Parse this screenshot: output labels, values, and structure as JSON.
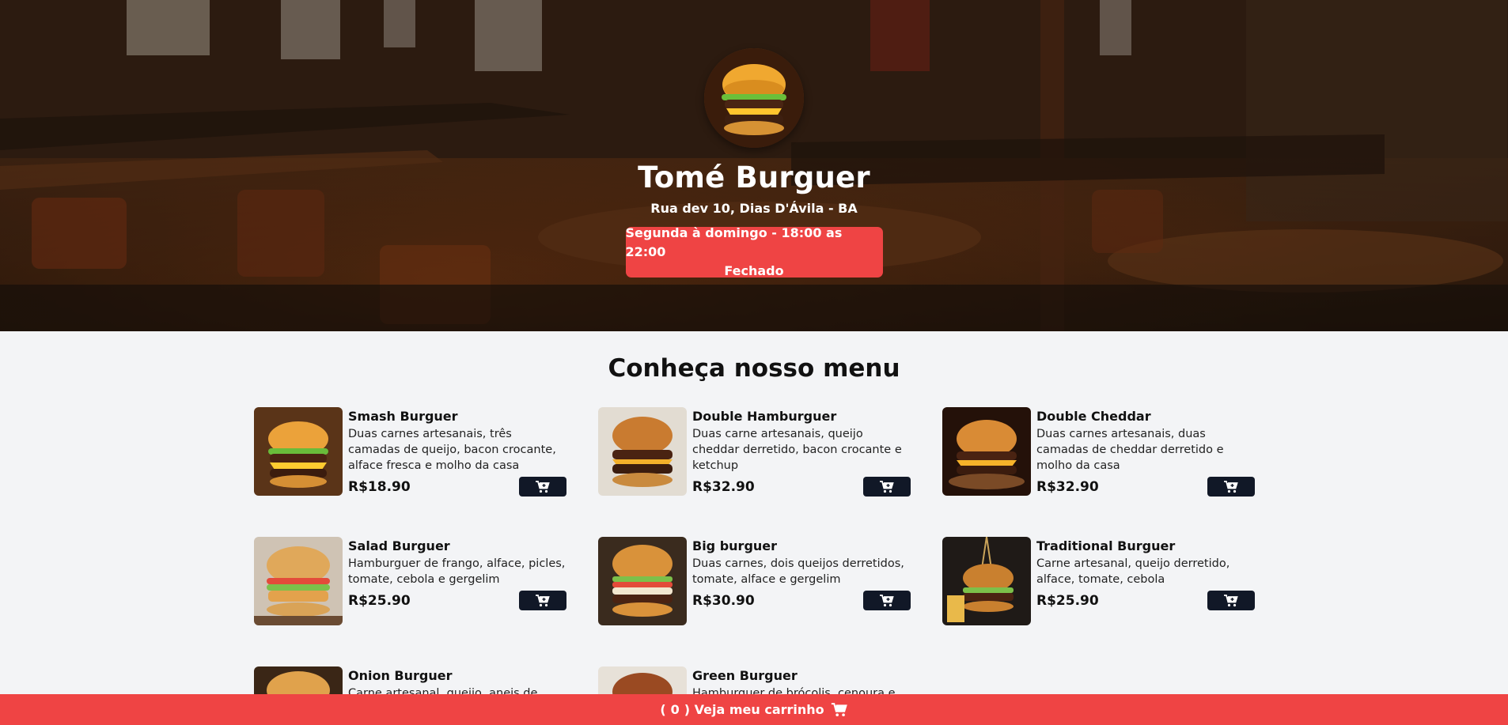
{
  "header": {
    "name": "Tomé Burguer",
    "address": "Rua dev 10, Dias D'Ávila - BA",
    "hours": "Segunda à domingo - 18:00 as 22:00",
    "status": "Fechado",
    "logo_icon": "burger-logo-icon"
  },
  "menu": {
    "title": "Conheça nosso menu",
    "items": [
      {
        "name": "Smash Burguer",
        "description": "Duas carnes artesanais, três camadas de queijo, bacon crocante, alface fresca e molho da casa",
        "price": "R$18.90"
      },
      {
        "name": "Double Hamburguer",
        "description": "Duas carne artesanais, queijo cheddar derretido, bacon crocante e ketchup",
        "price": "R$32.90"
      },
      {
        "name": "Double Cheddar",
        "description": "Duas carnes artesanais, duas camadas de cheddar derretido e molho da casa",
        "price": "R$32.90"
      },
      {
        "name": "Salad Burguer",
        "description": "Hamburguer de frango, alface, picles, tomate, cebola e gergelim",
        "price": "R$25.90"
      },
      {
        "name": "Big burguer",
        "description": "Duas carnes, dois queijos derretidos, tomate, alface e gergelim",
        "price": "R$30.90"
      },
      {
        "name": "Traditional Burguer",
        "description": "Carne artesanal, queijo derretido, alface, tomate, cebola",
        "price": "R$25.90"
      },
      {
        "name": "Onion Burguer",
        "description": "Carne artesanal, queijo, aneis de",
        "price": ""
      },
      {
        "name": "Green Burguer",
        "description": "Hamburguer de brócolis, cenoura e",
        "price": ""
      }
    ]
  },
  "cart": {
    "open_paren": "(",
    "count": "0",
    "label": ") Veja meu carrinho",
    "icon": "cart-icon"
  },
  "colors": {
    "accent": "#ef4444",
    "button": "#111827",
    "background": "#f3f4f6"
  }
}
